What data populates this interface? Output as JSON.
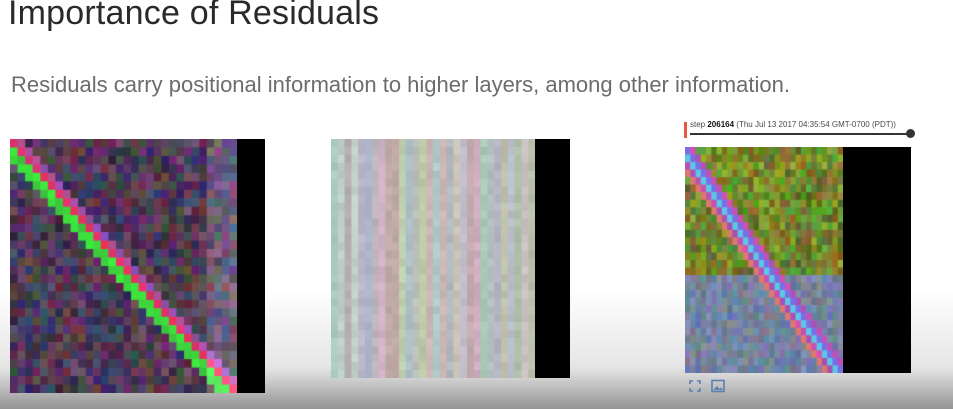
{
  "slide": {
    "title": "Importance of Residuals",
    "subtitle": "Residuals carry positional information to higher layers, among other information."
  },
  "figures": [
    {
      "name": "attention-heatmap-with-residuals",
      "pattern": "diagonal",
      "grid_cells": 30
    },
    {
      "name": "attention-heatmap-without-residuals",
      "pattern": "vertical-stripes",
      "grid_cells": 30
    },
    {
      "name": "attention-heatmap-tensorboard",
      "pattern": "diagonal-bright",
      "grid_cells": 30
    }
  ],
  "tensorboard": {
    "step_label": "step",
    "step_value": "206164",
    "step_time": "(Thu Jul 13 2017 04:35:54 GMT-0700 (PDT))"
  },
  "icons": [
    "expand-icon",
    "image-icon"
  ],
  "colors": {
    "title": "#2a2a2a",
    "subtitle": "#6c6c6c",
    "step_marker": "#e8563f",
    "bar": "#000000"
  }
}
